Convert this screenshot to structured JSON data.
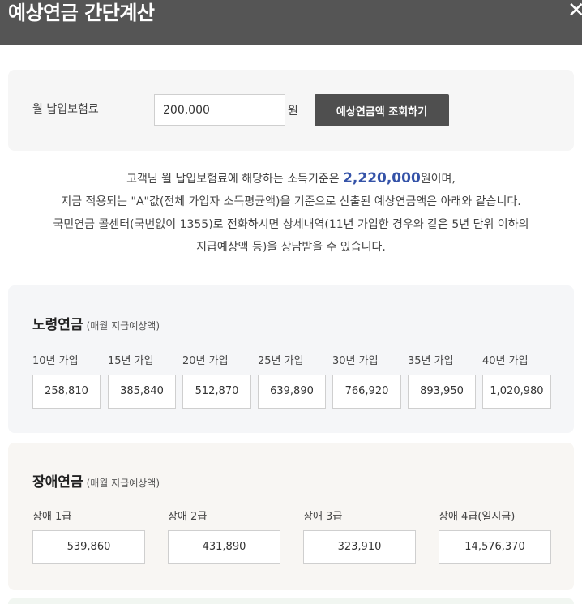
{
  "header": {
    "title": "예상연금 간단계산",
    "close_icon": "close-icon"
  },
  "form": {
    "label": "월 납입보험료",
    "input_value": "200,000",
    "unit": "원",
    "button_label": "예상연금액 조회하기"
  },
  "description": {
    "line1_prefix": "고객님 월 납입보험료에 해당하는 소득기준은 ",
    "line1_amount": "2,220,000",
    "line1_suffix": "원이며,",
    "line2": "지금 적용되는 \"A\"값(전체 가입자 소득평균액)을 기준으로 산출된 예상연금액은 아래와 같습니다.",
    "line3": "국민연금 콜센터(국번없이 1355)로 전화하시면 상세내역(11년 가입한 경우와 같은 5년 단위 이하의",
    "line4": "지급예상액 등)을 상담받을 수 있습니다."
  },
  "old_age": {
    "title": "노령연금",
    "subtitle": "(매월 지급예상액)",
    "items": [
      {
        "label": "10년 가입",
        "value": "258,810"
      },
      {
        "label": "15년 가입",
        "value": "385,840"
      },
      {
        "label": "20년 가입",
        "value": "512,870"
      },
      {
        "label": "25년 가입",
        "value": "639,890"
      },
      {
        "label": "30년 가입",
        "value": "766,920"
      },
      {
        "label": "35년 가입",
        "value": "893,950"
      },
      {
        "label": "40년 가입",
        "value": "1,020,980"
      }
    ]
  },
  "disability": {
    "title": "장애연금",
    "subtitle": "(매월 지급예상액)",
    "items": [
      {
        "label": "장애 1급",
        "value": "539,860"
      },
      {
        "label": "장애 2급",
        "value": "431,890"
      },
      {
        "label": "장애 3급",
        "value": "323,910"
      },
      {
        "label": "장애 4급(일시금)",
        "value": "14,576,370"
      }
    ]
  },
  "colors": {
    "header_bg": "#555555",
    "button_bg": "#4f4f4f",
    "amount_accent": "#3553a8"
  }
}
